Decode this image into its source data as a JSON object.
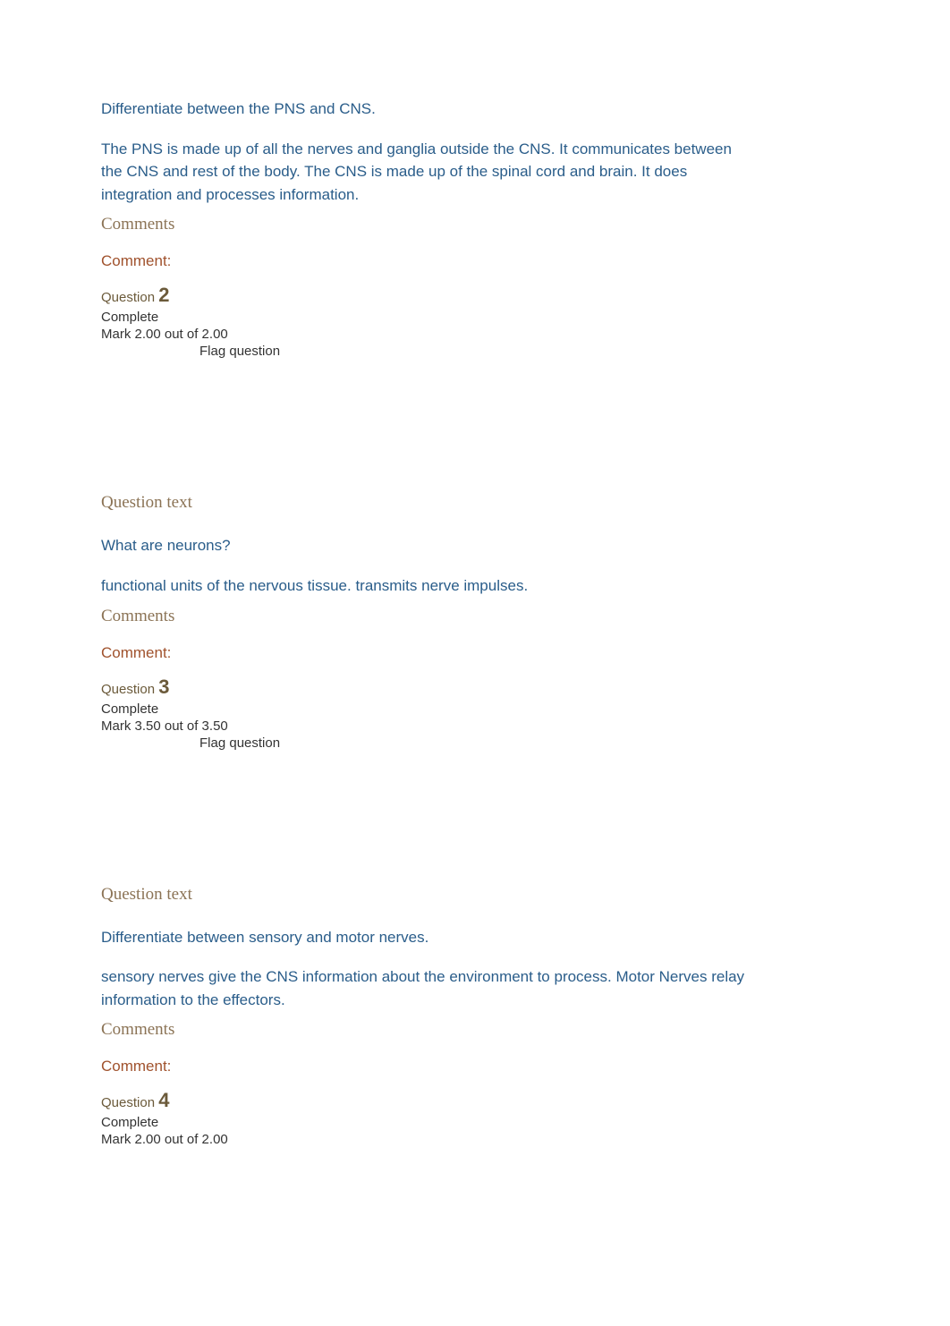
{
  "questions": [
    {
      "prompt": "Differentiate between the PNS and CNS.",
      "answer": "The PNS is made up of all the nerves and ganglia outside the CNS. It communicates between the CNS and rest of the body. The CNS is made up of the spinal cord and brain. It does integration and processes information.",
      "comments_heading": "Comments",
      "comment_label": "Comment:",
      "question_label": "Question ",
      "number": "2",
      "status": "Complete",
      "mark": "Mark 2.00 out of 2.00",
      "flag": "Flag question"
    },
    {
      "question_text_heading": "Question text",
      "prompt": "What are neurons?",
      "answer": "functional units of the nervous tissue. transmits nerve impulses.",
      "comments_heading": "Comments",
      "comment_label": "Comment:",
      "question_label": "Question ",
      "number": "3",
      "status": "Complete",
      "mark": "Mark 3.50 out of 3.50",
      "flag": "Flag question"
    },
    {
      "question_text_heading": "Question text",
      "prompt": "Differentiate between sensory and motor nerves.",
      "answer": "sensory nerves give the CNS information about the environment to process. Motor Nerves relay information to the effectors.",
      "comments_heading": "Comments",
      "comment_label": "Comment:",
      "question_label": "Question ",
      "number": "4",
      "status": "Complete",
      "mark": "Mark 2.00 out of 2.00"
    }
  ]
}
